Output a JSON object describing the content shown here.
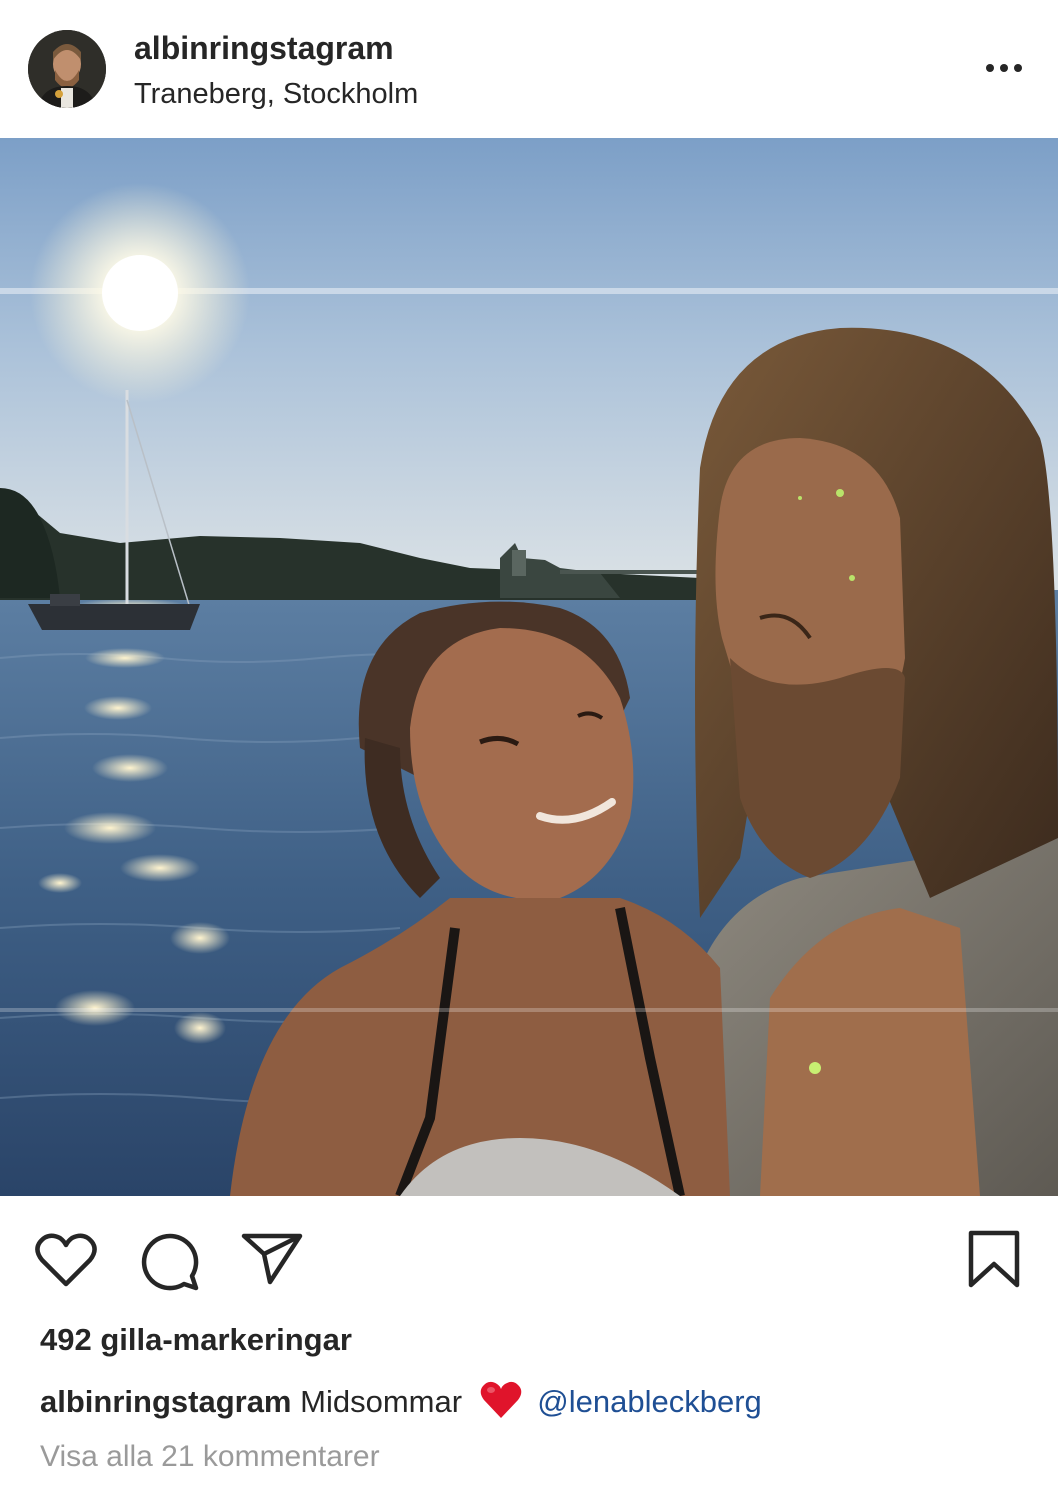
{
  "post": {
    "username": "albinringstagram",
    "location": "Traneberg, Stockholm",
    "more_icon": "more-horizontal-icon"
  },
  "actions": {
    "like_icon": "heart-outline-icon",
    "comment_icon": "comment-bubble-icon",
    "share_icon": "paper-plane-icon",
    "save_icon": "bookmark-icon"
  },
  "likes_text": "492 gilla-markeringar",
  "caption": {
    "username": "albinringstagram",
    "text": "Midsommar",
    "emoji": "red-heart",
    "mention": "@lenableckberg"
  },
  "comments_link": "Visa alla 21 kommentarer",
  "colors": {
    "text": "#262626",
    "muted": "#9a9a9a",
    "mention": "#1f4f94",
    "heart": "#e0142b"
  }
}
